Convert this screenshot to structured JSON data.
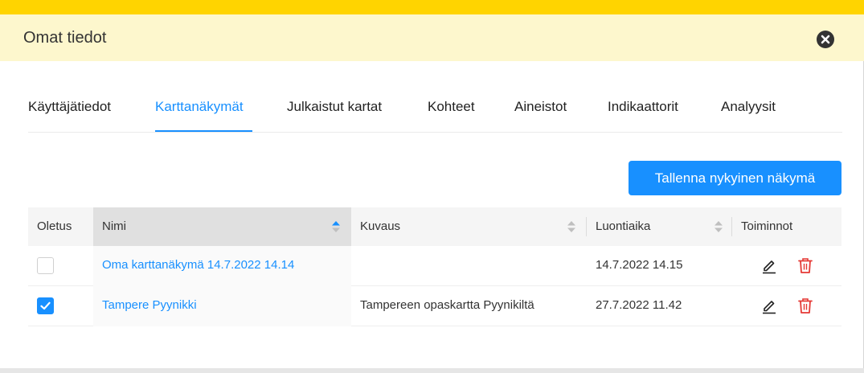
{
  "header": {
    "title": "Omat tiedot"
  },
  "tabs": [
    {
      "label": "Käyttäjätiedot"
    },
    {
      "label": "Karttanäkymät"
    },
    {
      "label": "Julkaistut kartat"
    },
    {
      "label": "Kohteet"
    },
    {
      "label": "Aineistot"
    },
    {
      "label": "Indikaattorit"
    },
    {
      "label": "Analyysit"
    }
  ],
  "active_tab": "Karttanäkymät",
  "save_button_label": "Tallenna nykyinen näkymä",
  "table": {
    "columns": [
      {
        "label": "Oletus"
      },
      {
        "label": "Nimi"
      },
      {
        "label": "Kuvaus"
      },
      {
        "label": "Luontiaika"
      },
      {
        "label": "Toiminnot"
      }
    ],
    "sorted_column": "Nimi",
    "sort_direction": "ascending",
    "rows": [
      {
        "default": false,
        "name": "Oma karttanäkymä 14.7.2022 14.14",
        "description": "",
        "created": "14.7.2022 14.15"
      },
      {
        "default": true,
        "name": "Tampere Pyynikki",
        "description": "Tampereen opaskartta Pyynikiltä",
        "created": "27.7.2022 11.42"
      }
    ]
  },
  "icons": {
    "close": "close-circle-icon",
    "edit": "pencil-icon",
    "delete": "trash-icon",
    "sort": "sort-arrows-icon",
    "check": "check-icon"
  },
  "colors": {
    "accent": "#1890ff",
    "top_bar": "#ffd400",
    "header_bg": "#fdf7cd",
    "delete": "#e53935"
  }
}
